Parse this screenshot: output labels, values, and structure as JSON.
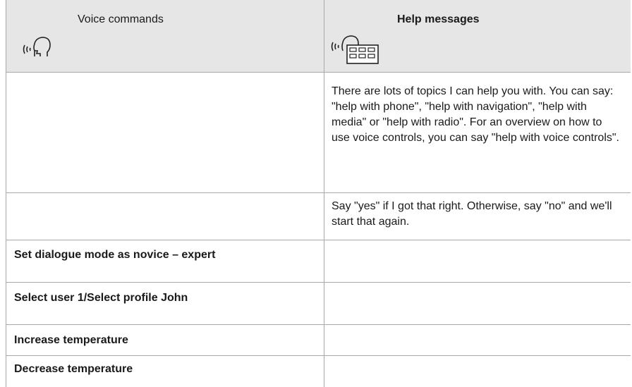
{
  "header": {
    "col1_title": "Voice commands",
    "col2_title": "Help messages",
    "col1_icon": "speaking-head-icon",
    "col2_icon": "speaking-head-keypad-icon"
  },
  "rows": [
    {
      "command": "",
      "message": "There are lots of topics I can help you with. You can say: \"help with phone\", \"help with navigation\", \"help with media\" or \"help with radio\". For an overview on how to use voice controls, you can say \"help with voice controls\"."
    },
    {
      "command": "",
      "message": "Say \"yes\" if I got that right. Otherwise, say \"no\" and we'll start that again."
    },
    {
      "command": "Set dialogue mode as novice – expert",
      "message": ""
    },
    {
      "command": "Select user 1/Select profile John",
      "message": ""
    },
    {
      "command": "Increase temperature",
      "message": ""
    },
    {
      "command": "Decrease temperature",
      "message": ""
    }
  ]
}
